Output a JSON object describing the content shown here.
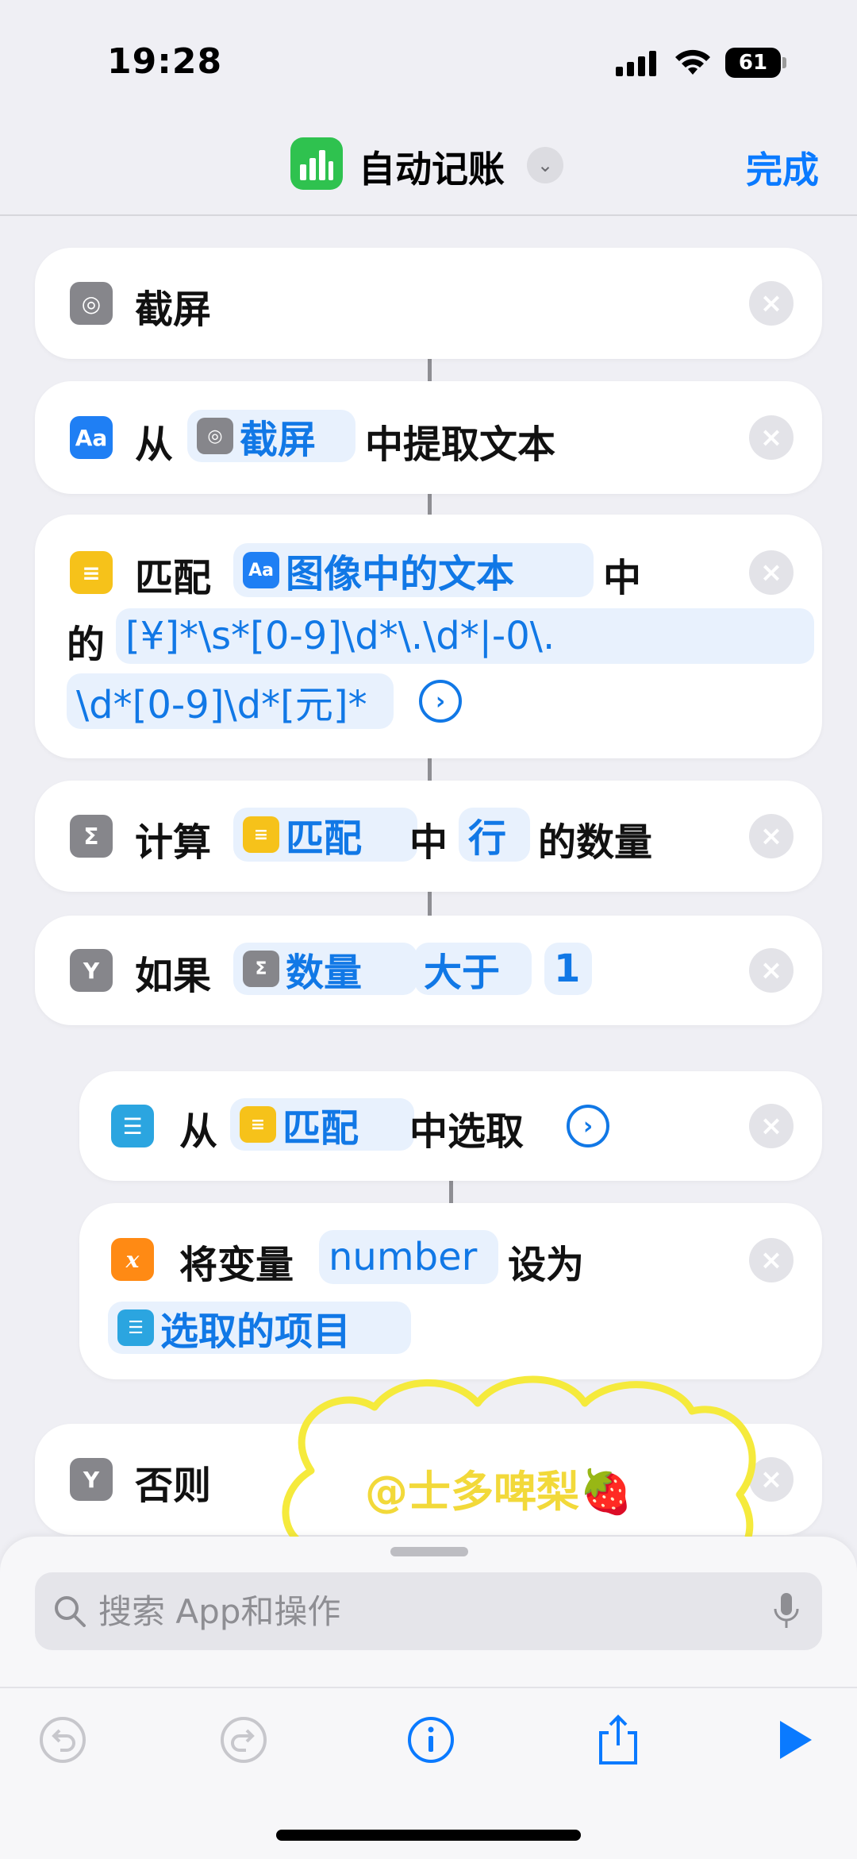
{
  "status": {
    "time": "19:28",
    "battery": "61"
  },
  "nav": {
    "title": "自动记账",
    "done": "完成"
  },
  "actions": {
    "screenshot": {
      "label": "截屏"
    },
    "extract": {
      "from": "从",
      "token": "截屏",
      "suffix": "中提取文本"
    },
    "match": {
      "label": "匹配",
      "token": "图像中的文本",
      "zh": "中",
      "of": "的",
      "regex_line1": "[¥]*\\s*[0-9]\\d*\\.\\d*|-0\\.",
      "regex_line2": "\\d*[0-9]\\d*[元]*"
    },
    "count": {
      "label": "计算",
      "token1": "匹配",
      "mid": "中",
      "token2": "行",
      "suffix": "的数量"
    },
    "if": {
      "label": "如果",
      "token1": "数量",
      "token2": "大于",
      "token3": "1"
    },
    "pick": {
      "from": "从",
      "token": "匹配",
      "suffix": "中选取"
    },
    "setvar": {
      "label": "将变量",
      "var": "number",
      "to": "设为",
      "token": "选取的项目"
    },
    "otherwise": {
      "label": "否则"
    }
  },
  "watermark": {
    "text": "@士多啤梨🍓"
  },
  "search": {
    "placeholder": "搜索 App和操作"
  },
  "colors": {
    "accent": "#0a7aff",
    "token_bg": "#e8f1fd",
    "background": "#efeff4"
  }
}
